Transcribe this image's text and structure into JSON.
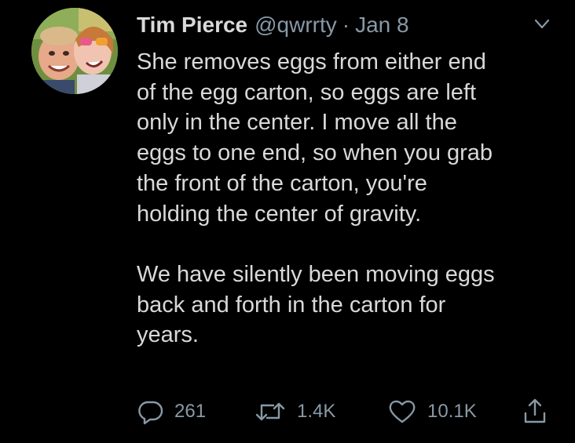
{
  "tweet": {
    "author": {
      "display_name": "Tim Pierce",
      "handle": "@qwrrty",
      "avatar_icon": "avatar-photo"
    },
    "separator": "·",
    "date": "Jan 8",
    "menu_icon": "chevron-down-icon",
    "text": "She removes eggs from either end\nof the egg carton, so eggs are left\nonly in the center. I move all the\neggs to one end, so when you grab\nthe front of the carton, you're\nholding the center of gravity.\n\nWe have silently been moving eggs\nback and forth in the carton for\nyears.",
    "actions": {
      "reply": {
        "icon": "reply-icon",
        "count": "261"
      },
      "retweet": {
        "icon": "retweet-icon",
        "count": "1.4K"
      },
      "like": {
        "icon": "heart-icon",
        "count": "10.1K"
      },
      "share": {
        "icon": "share-icon"
      }
    }
  },
  "colors": {
    "background": "#000000",
    "primary_text": "#d9d9d9",
    "secondary_text": "#8899a6"
  }
}
